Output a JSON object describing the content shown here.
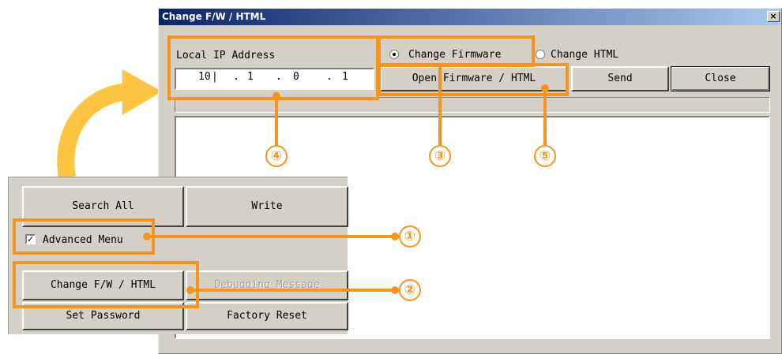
{
  "dialog": {
    "title": "Change F/W / HTML",
    "close_glyph": "×",
    "local_ip_label": "Local IP Address",
    "ip": [
      "10",
      "1",
      "0",
      "1"
    ],
    "ip_separator": ".",
    "radio_firmware_label": "Change Firmware",
    "radio_html_label": "Change HTML",
    "selected_radio": "Change Firmware",
    "open_button": "Open Firmware / HTML",
    "send_button": "Send",
    "close_button": "Close"
  },
  "panel": {
    "search_all_button": "Search All",
    "write_button": "Write",
    "advanced_menu_label": "Advanced Menu",
    "advanced_menu_checked": true,
    "checkmark": "✓",
    "change_fw_button": "Change F/W / HTML",
    "debugging_button": "Debugging Message",
    "set_password_button": "Set Password",
    "factory_reset_button": "Factory Reset"
  },
  "callouts": [
    "①",
    "②",
    "③",
    "④",
    "⑤"
  ],
  "colors": {
    "annotation": "#f7941d",
    "arrow": "#fdc43f",
    "titlebar": "#0a246a"
  }
}
